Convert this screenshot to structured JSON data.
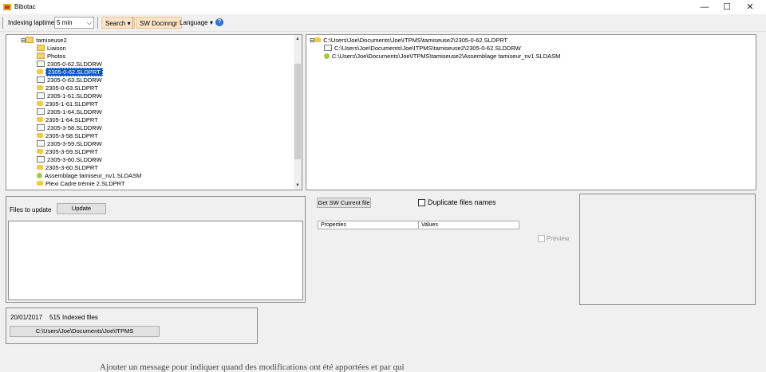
{
  "window": {
    "title": "Bibotac",
    "minimize_glyph": "—",
    "maximize_glyph": "☐",
    "close_glyph": "✕"
  },
  "toolbar": {
    "indexing_label": "Indexing laptime",
    "laptime_value": "5 min",
    "search_label": "Search",
    "sw_docmngr_label": "SW Docmngr",
    "language_label": "Language",
    "help_glyph": "?"
  },
  "tree": {
    "root": "tamiseuse2",
    "items": [
      {
        "label": "Liaison",
        "icon": "folder-icon"
      },
      {
        "label": "Photos",
        "icon": "folder-icon"
      },
      {
        "label": "2305-0-62.SLDDRW",
        "icon": "drawing-file-icon"
      },
      {
        "label": "2305-0-62.SLDPRT",
        "icon": "part-file-icon",
        "selected": true
      },
      {
        "label": "2305-0-63.SLDDRW",
        "icon": "drawing-file-icon"
      },
      {
        "label": "2305-0-63.SLDPRT",
        "icon": "part-file-icon"
      },
      {
        "label": "2305-1-61.SLDDRW",
        "icon": "drawing-file-icon"
      },
      {
        "label": "2305-1-61.SLDPRT",
        "icon": "part-file-icon"
      },
      {
        "label": "2305-1-64.SLDDRW",
        "icon": "drawing-file-icon"
      },
      {
        "label": "2305-1-64.SLDPRT",
        "icon": "part-file-icon"
      },
      {
        "label": "2305-3-58.SLDDRW",
        "icon": "drawing-file-icon"
      },
      {
        "label": "2305-3-58.SLDPRT",
        "icon": "part-file-icon"
      },
      {
        "label": "2305-3-59.SLDDRW",
        "icon": "drawing-file-icon"
      },
      {
        "label": "2305-3-59.SLDPRT",
        "icon": "part-file-icon"
      },
      {
        "label": "2305-3-60.SLDDRW",
        "icon": "drawing-file-icon"
      },
      {
        "label": "2305-3-60.SLDPRT",
        "icon": "part-file-icon"
      },
      {
        "label": "Assemblage tamiseur_nv1.SLDASM",
        "icon": "assembly-file-icon"
      },
      {
        "label": "Plexi Cadre trémie 2.SLDPRT",
        "icon": "part-file-icon"
      }
    ]
  },
  "refs_tree": {
    "root": "C:\\Users\\Joe\\Documents\\Joe\\ITPMS\\tamiseuse2\\2305-0-62.SLDPRT",
    "children": [
      "C:\\Users\\Joe\\Documents\\Joe\\ITPMS\\tamiseuse2\\2305-0-62.SLDDRW",
      "C:\\Users\\Joe\\Documents\\Joe\\ITPMS\\tamiseuse2\\Assemblage tamiseur_nv1.SLDASM"
    ]
  },
  "update_panel": {
    "label": "Files to update",
    "button": "Update"
  },
  "status_panel": {
    "date": "20/01/2017",
    "indexed_count": "515",
    "indexed_label": "Indexed files",
    "path": "C:\\Users\\Joe\\Documents\\Joe\\ITPMS"
  },
  "properties": {
    "get_button": "Get SW Current file",
    "duplicate_label": "Duplicate files names",
    "col_properties": "Properties",
    "col_values": "Values",
    "preview_label": "Preview"
  },
  "background_text": "Ajouter un message pour indiquer quand des modifications ont été apportées et par qui"
}
